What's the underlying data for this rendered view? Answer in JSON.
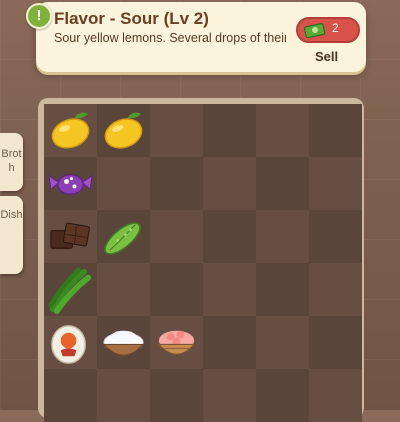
{
  "item_panel": {
    "title": "Flavor - Sour (Lv 2)",
    "description": "Sour yellow lemons. Several drops of their juice will make foods quite",
    "price": "2",
    "sell_label": "Sell",
    "info_badge": "!",
    "price_icon": "cash-icon"
  },
  "side_tabs": [
    {
      "label": "Broth"
    },
    {
      "label": "Dish"
    }
  ],
  "inventory": {
    "columns": 6,
    "rows": 6,
    "items": [
      {
        "name": "lemon",
        "icon": "lemon-icon",
        "row": 1,
        "col": 1
      },
      {
        "name": "lemon",
        "icon": "lemon-icon",
        "row": 1,
        "col": 2
      },
      {
        "name": "candy",
        "icon": "candy-icon",
        "row": 2,
        "col": 1
      },
      {
        "name": "chocolate",
        "icon": "chocolate-icon",
        "row": 3,
        "col": 1
      },
      {
        "name": "bitter melon",
        "icon": "bitter-melon-icon",
        "row": 3,
        "col": 2
      },
      {
        "name": "green peppers",
        "icon": "green-pepper-icon",
        "row": 4,
        "col": 1
      },
      {
        "name": "salted egg",
        "icon": "salted-egg-icon",
        "row": 5,
        "col": 1
      },
      {
        "name": "rice bowl",
        "icon": "rice-bowl-icon",
        "row": 5,
        "col": 2
      },
      {
        "name": "shrimp bowl",
        "icon": "shrimp-bowl-icon",
        "row": 5,
        "col": 3
      }
    ]
  }
}
